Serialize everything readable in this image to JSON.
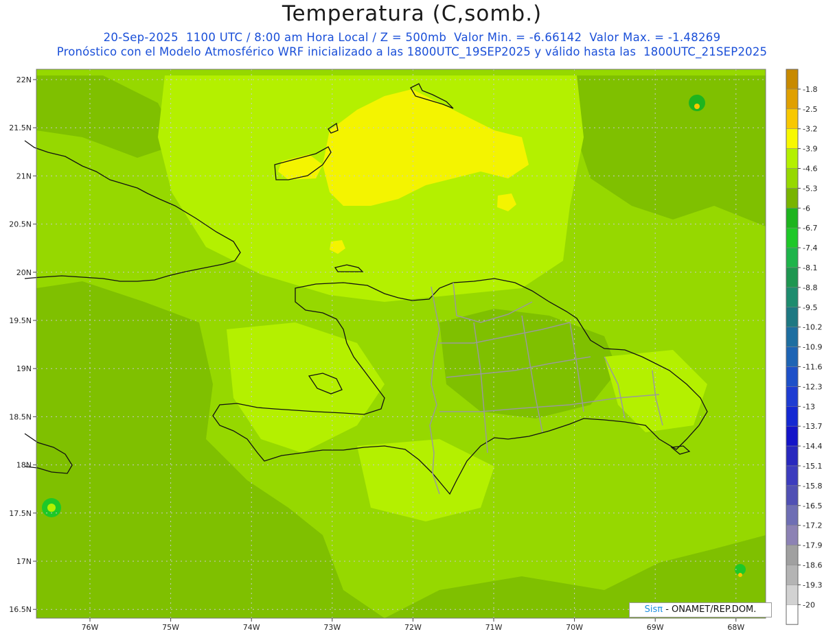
{
  "title": "Temperatura (C,somb.)",
  "subtitle_line1": "20-Sep-2025  1100 UTC / 8:00 am Hora Local / Z = 500mb  Valor Min. = -6.66142  Valor Max. = -1.48269",
  "subtitle_line2": "Pronóstico con el Modelo Atmosférico WRF inicializado a las 1800UTC_19SEP2025 y válido hasta las  1800UTC_21SEP2025",
  "lat_labels": [
    "22N",
    "21.5N",
    "21N",
    "20.5N",
    "20N",
    "19.5N",
    "19N",
    "18.5N",
    "18N",
    "17.5N",
    "17N",
    "16.5N"
  ],
  "lon_labels": [
    "76W",
    "75W",
    "74W",
    "73W",
    "72W",
    "71W",
    "70W",
    "69W",
    "68W"
  ],
  "colorbar_labels": [
    "-1.8",
    "-2.5",
    "-3.2",
    "-3.9",
    "-4.6",
    "-5.3",
    "-6",
    "-6.7",
    "-7.4",
    "-8.1",
    "-8.8",
    "-9.5",
    "-10.2",
    "-10.9",
    "-11.6",
    "-12.3",
    "-13",
    "-13.7",
    "-14.4",
    "-15.1",
    "-15.8",
    "-16.5",
    "-17.2",
    "-17.9",
    "-18.6",
    "-19.3",
    "-20"
  ],
  "colorbar_colors": [
    "#c88a00",
    "#e0a000",
    "#f8c800",
    "#f8f800",
    "#b4f000",
    "#96d800",
    "#78b400",
    "#1eb41e",
    "#1ec828",
    "#1eb44a",
    "#1e9650",
    "#1e8c6e",
    "#1e7882",
    "#1e6ea0",
    "#1e64b4",
    "#1e50c8",
    "#1e3cd2",
    "#1428d2",
    "#1414c8",
    "#2828be",
    "#3c3cbe",
    "#5050b4",
    "#6e6eb4",
    "#8c82b4",
    "#a0a0a0",
    "#b4b4b4",
    "#d2d2d2",
    "#ffffff"
  ],
  "credit_brand": "Sisπ",
  "credit_text": "- ONAMET/REP.DOM.",
  "field_colors": {
    "base": "#96d800",
    "dark": "#7fc000",
    "light": "#b4f000",
    "yellow": "#f4f400"
  }
}
